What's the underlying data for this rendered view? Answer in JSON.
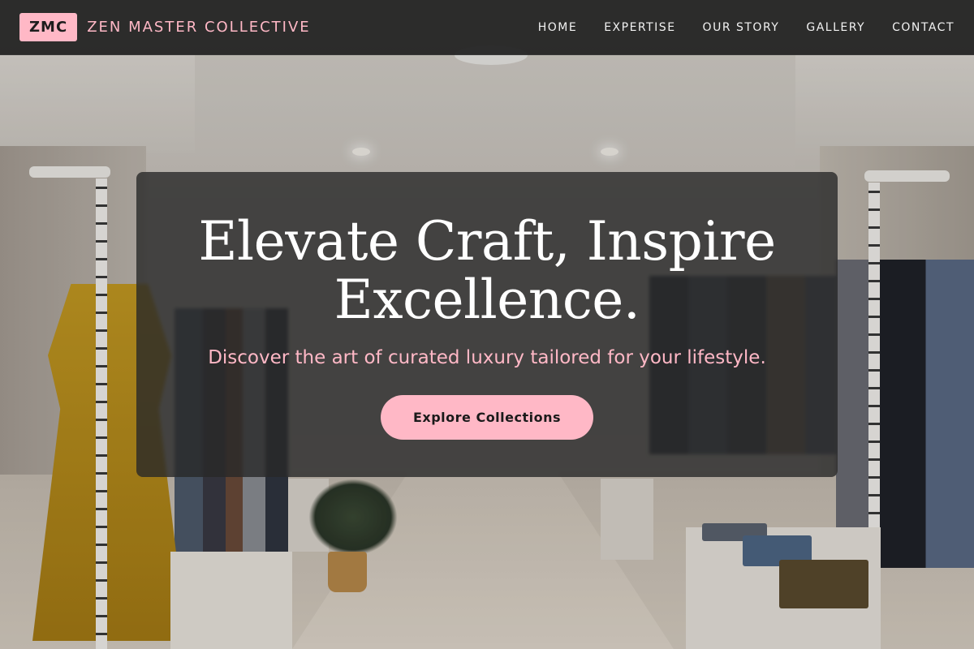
{
  "brand": {
    "logo_text": "ZMC",
    "name": "ZEN MASTER COLLECTIVE"
  },
  "nav": {
    "items": [
      {
        "label": "HOME"
      },
      {
        "label": "EXPERTISE"
      },
      {
        "label": "OUR STORY"
      },
      {
        "label": "GALLERY"
      },
      {
        "label": "CONTACT"
      }
    ]
  },
  "hero": {
    "title_line1": "Elevate Craft, Inspire",
    "title_line2": "Excellence.",
    "subtitle": "Discover the art of curated luxury tailored for your lifestyle.",
    "cta_label": "Explore Collections"
  },
  "colors": {
    "accent_pink": "#ffb8c6",
    "nav_bg": "#242424",
    "card_bg": "#282828"
  },
  "background_image": {
    "icon": "walk-in-closet-photo"
  }
}
